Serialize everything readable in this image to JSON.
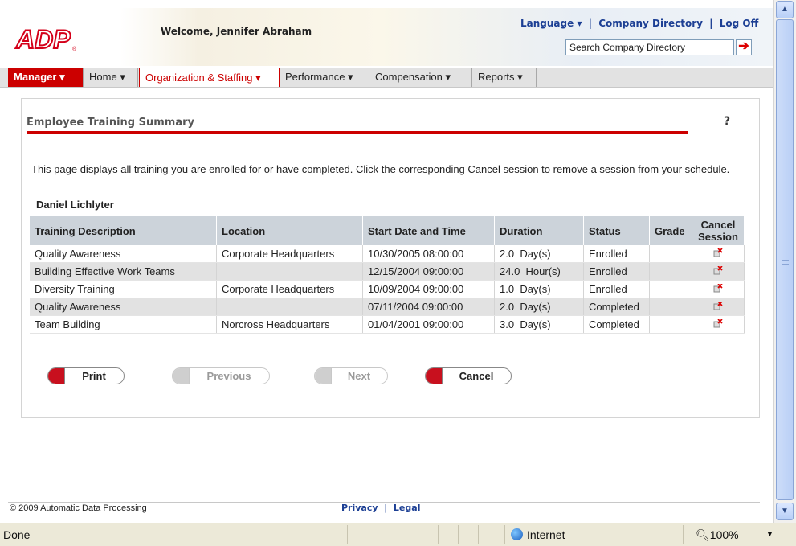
{
  "header": {
    "welcome": "Welcome, Jennifer Abraham",
    "links": {
      "language": "Language",
      "company_directory": "Company Directory",
      "log_off": "Log Off"
    },
    "search": {
      "value": "Search Company Directory"
    }
  },
  "nav": {
    "items": [
      {
        "label": "Manager",
        "has_menu": true
      },
      {
        "label": "Home",
        "has_menu": true
      },
      {
        "label": "Organization & Staffing",
        "has_menu": true,
        "active": true
      },
      {
        "label": "Performance",
        "has_menu": true
      },
      {
        "label": "Compensation",
        "has_menu": true
      },
      {
        "label": "Reports",
        "has_menu": true
      }
    ]
  },
  "page": {
    "title": "Employee Training Summary",
    "help": "?",
    "description": "This page displays all training you are enrolled for or have completed. Click the corresponding Cancel session to remove a session from your schedule.",
    "employee": "Daniel Lichlyter"
  },
  "table": {
    "headers": [
      "Training Description",
      "Location",
      "Start Date and Time",
      "Duration",
      "Status",
      "Grade",
      "Cancel Session"
    ],
    "rows": [
      {
        "description": "Quality Awareness",
        "location": "Corporate Headquarters",
        "start": "10/30/2005 08:00:00",
        "duration_value": "2.0",
        "duration_unit": "Day(s)",
        "status": "Enrolled",
        "grade": ""
      },
      {
        "description": "Building Effective Work Teams",
        "location": "",
        "start": "12/15/2004 09:00:00",
        "duration_value": "24.0",
        "duration_unit": "Hour(s)",
        "status": "Enrolled",
        "grade": ""
      },
      {
        "description": "Diversity Training",
        "location": "Corporate Headquarters",
        "start": "10/09/2004 09:00:00",
        "duration_value": "1.0",
        "duration_unit": "Day(s)",
        "status": "Enrolled",
        "grade": ""
      },
      {
        "description": "Quality Awareness",
        "location": "",
        "start": "07/11/2004 09:00:00",
        "duration_value": "2.0",
        "duration_unit": "Day(s)",
        "status": "Completed",
        "grade": ""
      },
      {
        "description": "Team Building",
        "location": "Norcross Headquarters",
        "start": "01/04/2001 09:00:00",
        "duration_value": "3.0",
        "duration_unit": "Day(s)",
        "status": "Completed",
        "grade": ""
      }
    ]
  },
  "buttons": {
    "print": "Print",
    "previous": "Previous",
    "next": "Next",
    "cancel": "Cancel"
  },
  "footer": {
    "copyright": "© 2009 Automatic Data Processing",
    "privacy": "Privacy",
    "legal": "Legal"
  },
  "statusbar": {
    "status": "Done",
    "zone": "Internet",
    "zoom": "100%"
  },
  "colors": {
    "brand_red": "#c00",
    "link_blue": "#1c3f94",
    "header_gray": "#ccd3da"
  }
}
